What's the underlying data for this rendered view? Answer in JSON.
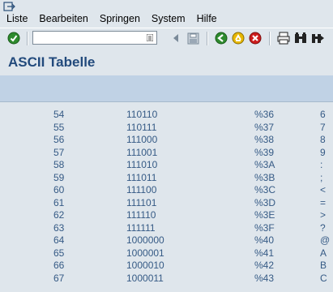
{
  "menu": {
    "items": [
      {
        "label": "Liste"
      },
      {
        "label": "Bearbeiten"
      },
      {
        "label": "Springen"
      },
      {
        "label": "System"
      },
      {
        "label": "Hilfe"
      }
    ]
  },
  "toolbar": {
    "command_value": "",
    "icons": [
      "enter-icon",
      "dropdown-icon",
      "back-arrow-icon",
      "save-icon",
      "back-icon",
      "exit-icon",
      "cancel-icon",
      "print-icon",
      "find-icon",
      "find-next-icon"
    ]
  },
  "title": "ASCII Tabelle",
  "rows": [
    {
      "dec": "54",
      "bin": "110110",
      "hex": "%36",
      "char": "6"
    },
    {
      "dec": "55",
      "bin": "110111",
      "hex": "%37",
      "char": "7"
    },
    {
      "dec": "56",
      "bin": "111000",
      "hex": "%38",
      "char": "8"
    },
    {
      "dec": "57",
      "bin": "111001",
      "hex": "%39",
      "char": "9"
    },
    {
      "dec": "58",
      "bin": "111010",
      "hex": "%3A",
      "char": ":"
    },
    {
      "dec": "59",
      "bin": "111011",
      "hex": "%3B",
      "char": ";"
    },
    {
      "dec": "60",
      "bin": "111100",
      "hex": "%3C",
      "char": "<"
    },
    {
      "dec": "61",
      "bin": "111101",
      "hex": "%3D",
      "char": "="
    },
    {
      "dec": "62",
      "bin": "111110",
      "hex": "%3E",
      "char": ">"
    },
    {
      "dec": "63",
      "bin": "111111",
      "hex": "%3F",
      "char": "?"
    },
    {
      "dec": "64",
      "bin": "1000000",
      "hex": "%40",
      "char": "@"
    },
    {
      "dec": "65",
      "bin": "1000001",
      "hex": "%41",
      "char": "A"
    },
    {
      "dec": "66",
      "bin": "1000010",
      "hex": "%42",
      "char": "B"
    },
    {
      "dec": "67",
      "bin": "1000011",
      "hex": "%43",
      "char": "C"
    }
  ],
  "colors": {
    "background": "#dfe6ec",
    "title": "#224a7c",
    "text": "#355a85",
    "appbar": "#c0d2e5"
  }
}
